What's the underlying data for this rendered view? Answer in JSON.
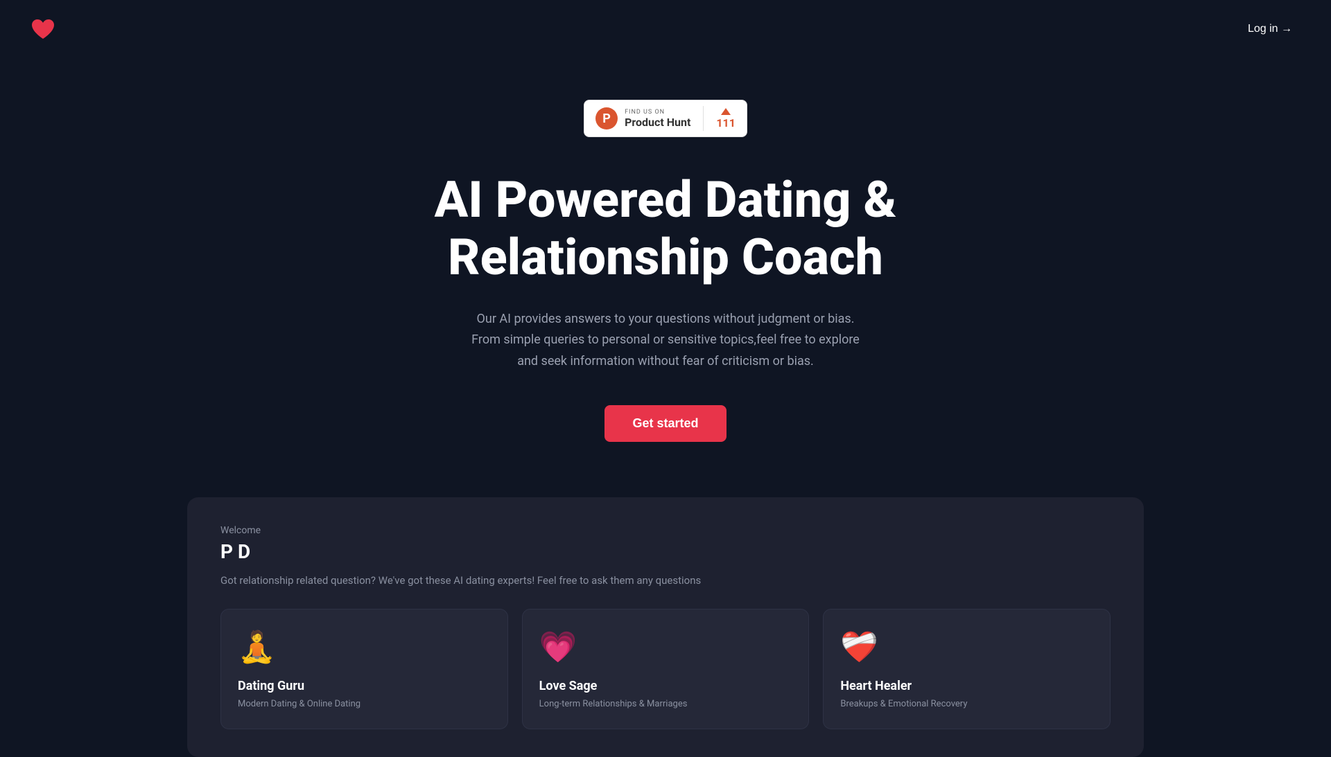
{
  "header": {
    "login_label": "Log in →"
  },
  "product_hunt": {
    "find_us_text": "FIND US ON",
    "name": "Product Hunt",
    "vote_count": "111"
  },
  "hero": {
    "title": "AI Powered Dating & Relationship Coach",
    "subtitle": "Our AI provides answers to your questions without judgment or bias. From simple queries to personal or sensitive topics,feel free to explore and seek information without fear of criticism or bias.",
    "cta_label": "Get started"
  },
  "welcome": {
    "label": "Welcome",
    "name": "P D",
    "description": "Got relationship related question? We've got these AI dating experts! Feel free to ask them any questions"
  },
  "cards": [
    {
      "icon": "🧘",
      "title": "Dating Guru",
      "subtitle": "Modern Dating & Online Dating"
    },
    {
      "icon": "💗",
      "title": "Love Sage",
      "subtitle": "Long-term Relationships & Marriages"
    },
    {
      "icon": "❤️‍🩹",
      "title": "Heart Healer",
      "subtitle": "Breakups & Emotional Recovery"
    }
  ]
}
